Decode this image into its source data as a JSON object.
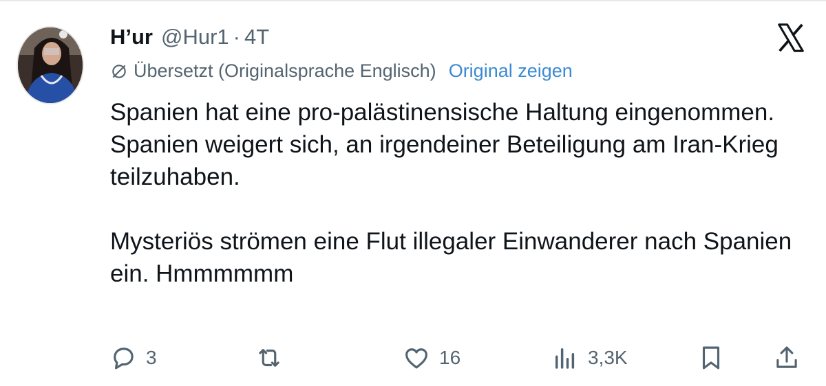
{
  "tweet": {
    "display_name": "H’ur",
    "handle": "@Hur1",
    "separator": "·",
    "time": "4T",
    "translation": {
      "label": "Übersetzt (Originalsprache Englisch)",
      "show_original": "Original zeigen"
    },
    "paragraphs": [
      "Spanien hat eine pro-palästinensische Haltung eingenommen.",
      "Spanien weigert sich, an irgendeiner Beteiligung am Iran-Krieg teilzuhaben.",
      "Mysteriös strömen eine Flut illegaler Einwanderer nach Spanien ein. Hmmmmmm"
    ]
  },
  "actions": {
    "replies": "3",
    "retweets": "",
    "likes": "16",
    "views": "3,3K"
  },
  "icons": {
    "platform_logo": "x-logo-icon",
    "translate": "translate-icon",
    "reply": "reply-icon",
    "retweet": "retweet-icon",
    "like": "heart-icon",
    "views": "views-icon",
    "bookmark": "bookmark-icon",
    "share": "share-icon"
  },
  "colors": {
    "text": "#0f1419",
    "secondary": "#536471",
    "link": "#3b8ad2"
  }
}
